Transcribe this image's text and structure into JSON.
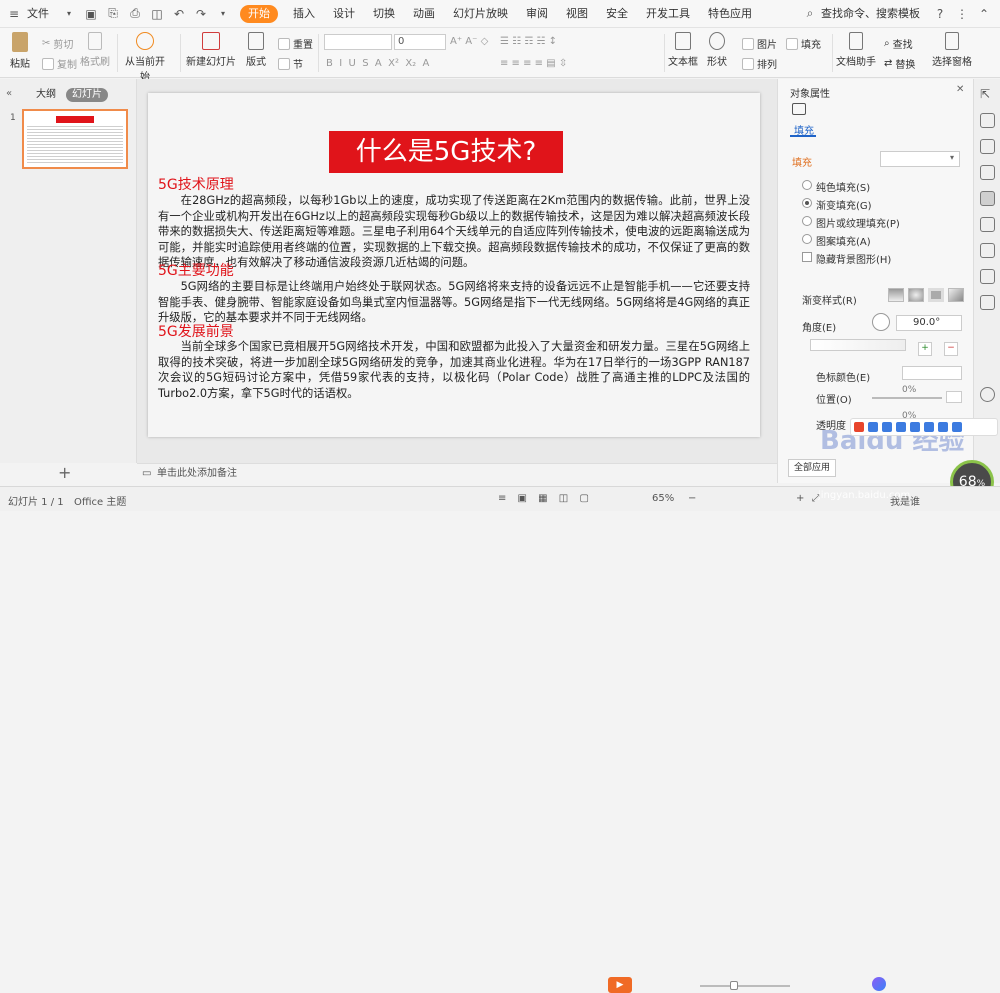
{
  "menubar": {
    "file_label": "文件",
    "tabs": [
      "开始",
      "插入",
      "设计",
      "切换",
      "动画",
      "幻灯片放映",
      "审阅",
      "视图",
      "安全",
      "开发工具",
      "特色应用"
    ],
    "search_label": "查找命令、搜索模板",
    "help": "?"
  },
  "ribbon": {
    "paste": "粘贴",
    "cut": "剪切",
    "copy": "复制",
    "format_painter": "格式刷",
    "play_from_current": "从当前开始",
    "new_slide": "新建幻灯片",
    "layout": "版式",
    "section": "节",
    "reset": "重置",
    "font_size": "0",
    "textbox": "文本框",
    "shape": "形状",
    "arrange": "排列",
    "picture": "图片",
    "fill": "填充",
    "find": "查找",
    "text_assistant": "文档助手",
    "replace": "替换",
    "select_pane": "选择窗格"
  },
  "left_panel": {
    "outline_tab": "大纲",
    "slides_tab": "幻灯片",
    "slide_number": "1",
    "add_label": "+"
  },
  "slide": {
    "title": "什么是5G技术?",
    "sections": [
      {
        "heading": "5G技术原理",
        "body": "在28GHz的超高频段，以每秒1Gb以上的速度，成功实现了传送距离在2Km范围内的数据传输。此前，世界上没有一个企业或机构开发出在6GHz以上的超高频段实现每秒Gb级以上的数据传输技术，这是因为难以解决超高频波长段带来的数据损失大、传送距离短等难题。三星电子利用64个天线单元的自适应阵列传输技术，使电波的远距离输送成为可能，并能实时追踪使用者终端的位置，实现数据的上下载交换。超高频段数据传输技术的成功，不仅保证了更高的数据传输速度，也有效解决了移动通信波段资源几近枯竭的问题。"
      },
      {
        "heading": "5G主要功能",
        "body": "5G网络的主要目标是让终端用户始终处于联网状态。5G网络将来支持的设备远远不止是智能手机——它还要支持智能手表、健身腕带、智能家庭设备如鸟巢式室内恒温器等。5G网络是指下一代无线网络。5G网络将是4G网络的真正升级版，它的基本要求并不同于无线网络。"
      },
      {
        "heading": "5G发展前景",
        "body": "当前全球多个国家已竟相展开5G网络技术开发，中国和欧盟都为此投入了大量资金和研发力量。三星在5G网络上取得的技术突破，将进一步加剧全球5G网络研发的竞争，加速其商业化进程。华为在17日举行的一场3GPP RAN187次会议的5G短码讨论方案中，凭借59家代表的支持，以极化码（Polar Code）战胜了高通主推的LDPC及法国的Turbo2.0方案，拿下5G时代的话语权。"
      }
    ]
  },
  "notes": {
    "placeholder": "单击此处添加备注"
  },
  "right_panel": {
    "title": "对象属性",
    "fill_tab": "填充",
    "fill_label": "填充",
    "options": [
      "纯色填充(S)",
      "渐变填充(G)",
      "图片或纹理填充(P)",
      "图案填充(A)"
    ],
    "selected_option": "渐变填充(G)",
    "hide_bg": "隐藏背景图形(H)",
    "gradient_style": "渐变样式(R)",
    "angle_label": "角度(E)",
    "angle_value": "90.0°",
    "color_label": "色标颜色(E)",
    "position_label": "位置(O)",
    "position_value": "0%",
    "transparency_label": "透明度",
    "transparency_value": "0%",
    "apply_all": "全部应用"
  },
  "statusbar": {
    "slide_info": "幻灯片 1 / 1",
    "theme": "Office 主题",
    "zoom": "65%",
    "account": "我是谁"
  },
  "watermark": {
    "brand": "Baidu 经验",
    "url": "jingyan.baidu.com",
    "speed": "68",
    "speed_unit": "%"
  }
}
